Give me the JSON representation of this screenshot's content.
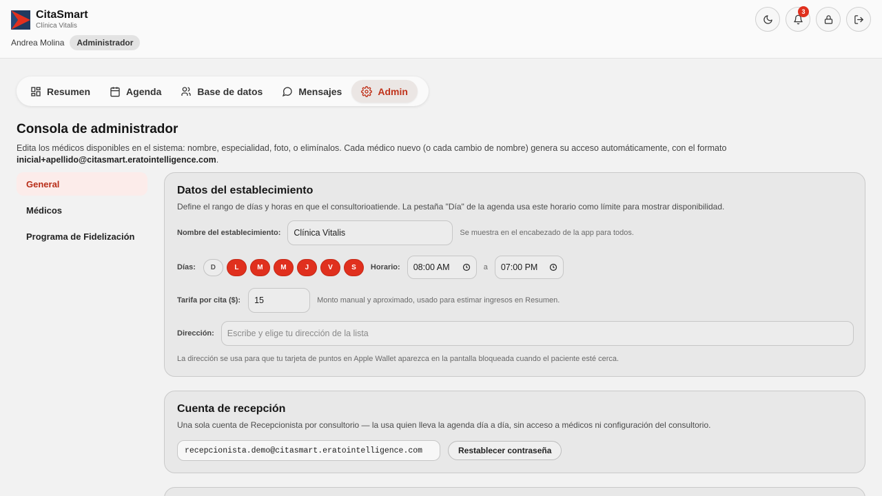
{
  "header": {
    "app_name": "CitaSmart",
    "clinic_name": "Clínica Vitalis",
    "user_name": "Andrea Molina",
    "role": "Administrador",
    "notifications_count": "3",
    "actions": [
      "moon-icon",
      "bell-icon",
      "lock-icon",
      "logout-icon"
    ]
  },
  "nav": {
    "tabs": [
      {
        "label": "Resumen",
        "icon": "grid-icon",
        "active": false
      },
      {
        "label": "Agenda",
        "icon": "calendar-icon",
        "active": false
      },
      {
        "label": "Base de datos",
        "icon": "users-icon",
        "active": false
      },
      {
        "label": "Mensajes",
        "icon": "chat-icon",
        "active": false
      },
      {
        "label": "Admin",
        "icon": "gear-icon",
        "active": true
      }
    ]
  },
  "page": {
    "title": "Consola de administrador",
    "description": "Edita los médicos disponibles en el sistema: nombre, especialidad, foto, o elimínalos. Cada médico nuevo (o cada cambio de nombre) genera su acceso automáticamente, con el formato ",
    "email_format": "inicial+apellido@citasmart.eratointelligence.com",
    "description_end": "."
  },
  "sidemenu": {
    "items": [
      {
        "label": "General",
        "active": true
      },
      {
        "label": "Médicos",
        "active": false
      },
      {
        "label": "Programa de Fidelización",
        "active": false
      }
    ]
  },
  "establishment": {
    "title": "Datos del establecimiento",
    "description": "Define el rango de días y horas en que el consultorioatiende. La pestaña \"Día\" de la agenda usa este horario como límite para mostrar disponibilidad.",
    "name_label": "Nombre del establecimiento:",
    "name_value": "Clínica Vitalis",
    "name_hint": "Se muestra en el encabezado de la app para todos.",
    "days_label": "Días:",
    "days": [
      {
        "letter": "D",
        "on": false
      },
      {
        "letter": "L",
        "on": true
      },
      {
        "letter": "M",
        "on": true
      },
      {
        "letter": "M",
        "on": true
      },
      {
        "letter": "J",
        "on": true
      },
      {
        "letter": "V",
        "on": true
      },
      {
        "letter": "S",
        "on": true
      }
    ],
    "schedule_label": "Horario:",
    "start_time": "08:00 AM",
    "to_label": "a",
    "end_time": "07:00 PM",
    "fee_label": "Tarifa por cita ($):",
    "fee_value": "15",
    "fee_hint": "Monto manual y aproximado, usado para estimar ingresos en Resumen.",
    "address_label": "Dirección:",
    "address_placeholder": "Escribe y elige tu dirección de la lista",
    "address_hint": "La dirección se usa para que tu tarjeta de puntos en Apple Wallet aparezca en la pantalla bloqueada cuando el paciente esté cerca."
  },
  "reception": {
    "title": "Cuenta de recepción",
    "description": "Una sola cuenta de Recepcionista por consultorio — la usa quien lleva la agenda día a día, sin acceso a médicos ni configuración del consultorio.",
    "email": "recepcionista.demo@citasmart.eratointelligence.com",
    "reset_label": "Restablecer contraseña"
  },
  "colors": {
    "accent": "#e0301e",
    "accent_text": "#c0321a",
    "logo_bg": "#1f3a5f"
  }
}
